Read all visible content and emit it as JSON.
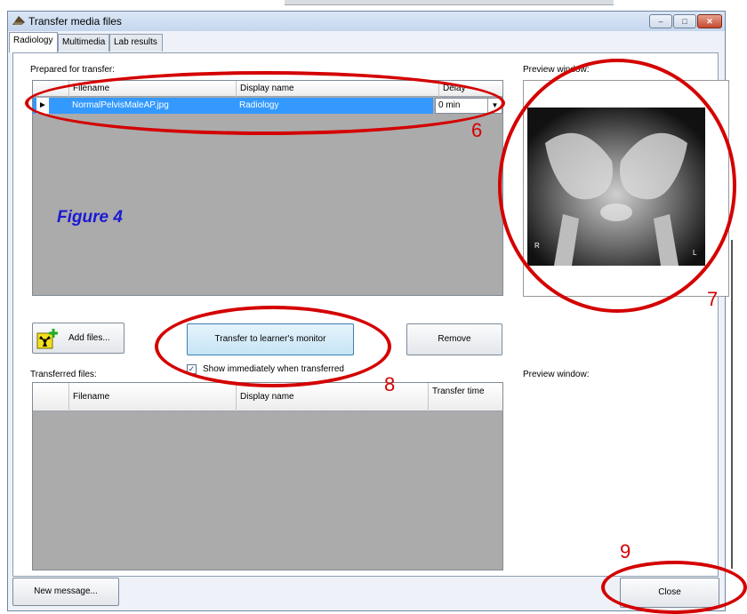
{
  "window": {
    "title": "Transfer media files",
    "controls": [
      "–",
      "□",
      "✕"
    ]
  },
  "tabs": [
    "Radiology",
    "Multimedia",
    "Lab results"
  ],
  "prepared": {
    "label": "Prepared for transfer:",
    "columns": {
      "filename": "Filename",
      "display": "Display name",
      "delay": "Delay"
    },
    "row": {
      "filename": "NormalPelvisMaleAP.jpg",
      "display": "Radiology",
      "delay": "0 min"
    }
  },
  "preview": {
    "label_top": "Preview window:",
    "label_bottom": "Preview window:",
    "xray_r": "R",
    "xray_l": "L"
  },
  "buttons": {
    "add_files": "Add files...",
    "transfer": "Transfer to learner's monitor",
    "remove": "Remove",
    "new_message": "New message...",
    "close": "Close"
  },
  "checkbox": {
    "label": "Show immediately when transferred",
    "checked": true
  },
  "transferred": {
    "label": "Transferred files:",
    "columns": {
      "filename": "Filename",
      "display": "Display name",
      "time": "Transfer time"
    }
  },
  "annotations": {
    "figure": "Figure 4",
    "n6": "6",
    "n7": "7",
    "n8": "8",
    "n9": "9"
  }
}
